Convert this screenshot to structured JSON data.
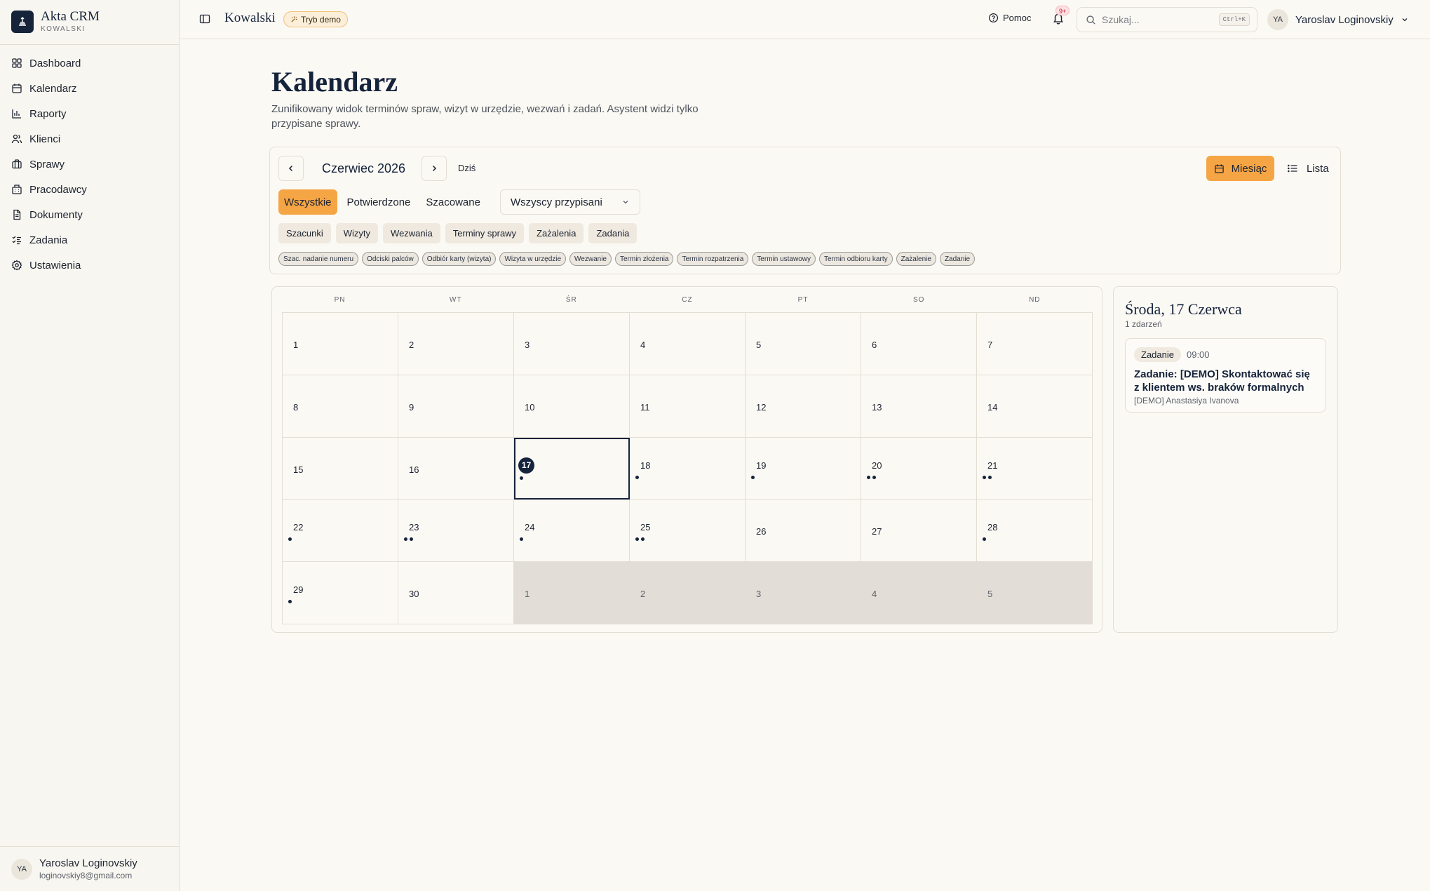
{
  "brand": {
    "name": "Akta CRM",
    "sub": "KOWALSKI"
  },
  "sidebar": {
    "items": [
      {
        "label": "Dashboard",
        "icon": "dashboard-icon"
      },
      {
        "label": "Kalendarz",
        "icon": "calendar-icon"
      },
      {
        "label": "Raporty",
        "icon": "bar-chart-icon"
      },
      {
        "label": "Klienci",
        "icon": "users-icon"
      },
      {
        "label": "Sprawy",
        "icon": "briefcase-icon"
      },
      {
        "label": "Pracodawcy",
        "icon": "building-icon"
      },
      {
        "label": "Dokumenty",
        "icon": "document-icon"
      },
      {
        "label": "Zadania",
        "icon": "tasks-icon"
      },
      {
        "label": "Ustawienia",
        "icon": "gear-icon"
      }
    ],
    "footer": {
      "initials": "YA",
      "name": "Yaroslav Loginovskiy",
      "email": "loginovskiy8@gmail.com"
    }
  },
  "topbar": {
    "title": "Kowalski",
    "demo_badge": "Tryb demo",
    "help": "Pomoc",
    "notification_count": "9+",
    "search_placeholder": "Szukaj...",
    "search_shortcut": "Ctrl+K",
    "user_initials": "YA",
    "user_name": "Yaroslav Loginovskiy"
  },
  "page": {
    "title": "Kalendarz",
    "description": "Zunifikowany widok terminów spraw, wizyt w urzędzie, wezwań i zadań. Asystent widzi tylko przypisane sprawy."
  },
  "toolbar": {
    "month_label": "Czerwiec 2026",
    "today": "Dziś",
    "view_month": "Miesiąc",
    "view_list": "Lista",
    "status_filters": [
      "Wszystkie",
      "Potwierdzone",
      "Szacowane"
    ],
    "active_status": "Wszystkie",
    "assignee": "Wszyscy przypisani",
    "categories": [
      "Szacunki",
      "Wizyty",
      "Wezwania",
      "Terminy sprawy",
      "Zażalenia",
      "Zadania"
    ],
    "chips": [
      "Szac. nadanie numeru",
      "Odciski palców",
      "Odbiór karty (wizyta)",
      "Wizyta w urzędzie",
      "Wezwanie",
      "Termin złożenia",
      "Termin rozpatrzenia",
      "Termin ustawowy",
      "Termin odbioru karty",
      "Zażalenie",
      "Zadanie"
    ]
  },
  "calendar": {
    "weekdays": [
      "PN",
      "WT",
      "ŚR",
      "CZ",
      "PT",
      "SO",
      "ND"
    ],
    "selected_day": 17,
    "days": [
      {
        "day": "1",
        "dots": 0,
        "other": false
      },
      {
        "day": "2",
        "dots": 0,
        "other": false
      },
      {
        "day": "3",
        "dots": 0,
        "other": false
      },
      {
        "day": "4",
        "dots": 0,
        "other": false
      },
      {
        "day": "5",
        "dots": 0,
        "other": false
      },
      {
        "day": "6",
        "dots": 0,
        "other": false
      },
      {
        "day": "7",
        "dots": 0,
        "other": false
      },
      {
        "day": "8",
        "dots": 0,
        "other": false
      },
      {
        "day": "9",
        "dots": 0,
        "other": false
      },
      {
        "day": "10",
        "dots": 0,
        "other": false
      },
      {
        "day": "11",
        "dots": 0,
        "other": false
      },
      {
        "day": "12",
        "dots": 0,
        "other": false
      },
      {
        "day": "13",
        "dots": 0,
        "other": false
      },
      {
        "day": "14",
        "dots": 0,
        "other": false
      },
      {
        "day": "15",
        "dots": 0,
        "other": false
      },
      {
        "day": "16",
        "dots": 0,
        "other": false
      },
      {
        "day": "17",
        "dots": 1,
        "other": false,
        "today": true
      },
      {
        "day": "18",
        "dots": 1,
        "other": false
      },
      {
        "day": "19",
        "dots": 1,
        "other": false
      },
      {
        "day": "20",
        "dots": 2,
        "other": false
      },
      {
        "day": "21",
        "dots": 2,
        "other": false
      },
      {
        "day": "22",
        "dots": 1,
        "other": false
      },
      {
        "day": "23",
        "dots": 2,
        "other": false
      },
      {
        "day": "24",
        "dots": 1,
        "other": false
      },
      {
        "day": "25",
        "dots": 2,
        "other": false
      },
      {
        "day": "26",
        "dots": 0,
        "other": false
      },
      {
        "day": "27",
        "dots": 0,
        "other": false
      },
      {
        "day": "28",
        "dots": 1,
        "other": false
      },
      {
        "day": "29",
        "dots": 1,
        "other": false
      },
      {
        "day": "30",
        "dots": 0,
        "other": false
      },
      {
        "day": "1",
        "dots": 0,
        "other": true
      },
      {
        "day": "2",
        "dots": 0,
        "other": true
      },
      {
        "day": "3",
        "dots": 0,
        "other": true
      },
      {
        "day": "4",
        "dots": 0,
        "other": true
      },
      {
        "day": "5",
        "dots": 0,
        "other": true
      }
    ]
  },
  "day_panel": {
    "title": "Środa, 17 Czerwca",
    "count": "1 zdarzeń",
    "events": [
      {
        "type": "Zadanie",
        "time": "09:00",
        "title": "Zadanie: [DEMO] Skontaktować się z klientem ws. braków formalnych",
        "assignee": "[DEMO] Anastasiya Ivanova"
      }
    ]
  },
  "colors": {
    "primary": "#15233b",
    "accent": "#f6a545",
    "background": "#fbf9f4"
  }
}
